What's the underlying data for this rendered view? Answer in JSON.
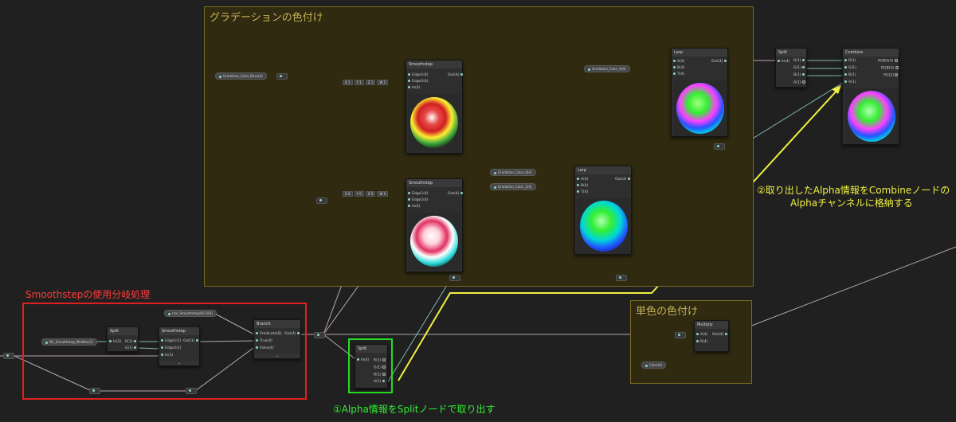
{
  "groups": {
    "gradient": {
      "title": "グラデーションの色付け"
    },
    "solid": {
      "title": "単色の色付け"
    }
  },
  "annotations": {
    "branch_label": "Smoothstepの使用分岐処理",
    "split_label": "①Alpha情報をSplitノードで取り出す",
    "combine_label_1": "②取り出したAlpha情報をCombineノードの",
    "combine_label_2": "Alphaチャンネルに格納する"
  },
  "properties": {
    "gradation_color_base": "Gradation_Color_Base(4)",
    "gradation_color_0": "Gradation_Color_0(4)",
    "gradation_color_0b": "Gradation_Color_0(4)",
    "gradation_color_1": "Gradation_Color_1(4)",
    "nc_smoothstep": "NC_Smoothstep_MinMax(2)",
    "use_smoothstep": "Use_Smoothstep(B)(1)(B)",
    "color": "Color(4)"
  },
  "vectors": {
    "top": [
      "X 1",
      "Y 1",
      "Z 1",
      "W 1"
    ],
    "bottom": [
      "X 0",
      "Y 0",
      "Z 0",
      "W 0"
    ]
  },
  "nodes": {
    "smoothstep_top": {
      "title": "Smoothstep",
      "inputs": [
        "Edge1(4)",
        "Edge2(4)",
        "In(4)"
      ],
      "output": "Out(4)"
    },
    "smoothstep_bottom": {
      "title": "Smoothstep",
      "inputs": [
        "Edge1(4)",
        "Edge2(4)",
        "In(4)"
      ],
      "output": "Out(4)"
    },
    "lerp_top": {
      "title": "Lerp",
      "inputs": [
        "A(4)",
        "B(4)",
        "T(4)"
      ],
      "output": "Out(4)"
    },
    "lerp_bottom": {
      "title": "Lerp",
      "inputs": [
        "A(4)",
        "B(4)",
        "T(4)"
      ],
      "output": "Out(4)"
    },
    "split_top": {
      "title": "Split",
      "input": "In(4)",
      "outputs": [
        "R(1)",
        "G(1)",
        "B(1)",
        "A(1)"
      ]
    },
    "combine": {
      "title": "Combine",
      "inputs": [
        "R(1)",
        "G(1)",
        "B(1)",
        "A(1)"
      ],
      "outputs": [
        "RGBA(4)",
        "RGB(3)",
        "RG(2)"
      ]
    },
    "split_branch": {
      "title": "Split",
      "input": "In(2)",
      "outputs": [
        "R(1)",
        "G(1)"
      ]
    },
    "smoothstep_branch": {
      "title": "Smoothstep",
      "inputs": [
        "Edge1(1)",
        "Edge2(1)",
        "In(1)"
      ],
      "output": "Out(1)"
    },
    "branch": {
      "title": "Branch",
      "inputs": [
        "Predicate(B)",
        "True(4)",
        "False(4)"
      ],
      "output": "Out(4)"
    },
    "split_alpha": {
      "title": "Split",
      "input": "In(4)",
      "outputs": [
        "R(1)",
        "G(1)",
        "B(1)",
        "A(1)"
      ]
    },
    "multiply": {
      "title": "Multiply",
      "inputs": [
        "A(4)",
        "B(4)"
      ],
      "output": "Out(4)"
    }
  },
  "colors": {
    "background": "#202020",
    "group_fill": "#2f2a10",
    "group_border": "#7a6a22",
    "red_frame": "#e02020",
    "green_frame": "#22dd22",
    "yellow_line": "#f0f040",
    "wire": "#b8a6b3",
    "wire_teal": "#7fb8b0"
  }
}
